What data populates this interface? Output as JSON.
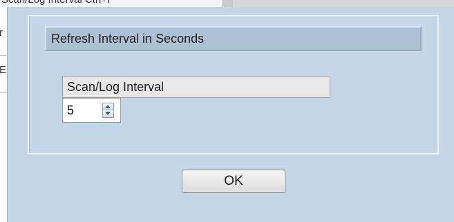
{
  "background": {
    "menu_text": "Scan/Log Interval   Ctrl+I",
    "left_column_letters": [
      "r",
      "E"
    ]
  },
  "dialog": {
    "group_title": "Refresh Interval in Seconds",
    "field_label": "Scan/Log Interval",
    "interval_value": "5",
    "ok_label": "OK"
  },
  "colors": {
    "dialog_bg": "#c4d6e8",
    "title_bg": "#aec2d6"
  }
}
